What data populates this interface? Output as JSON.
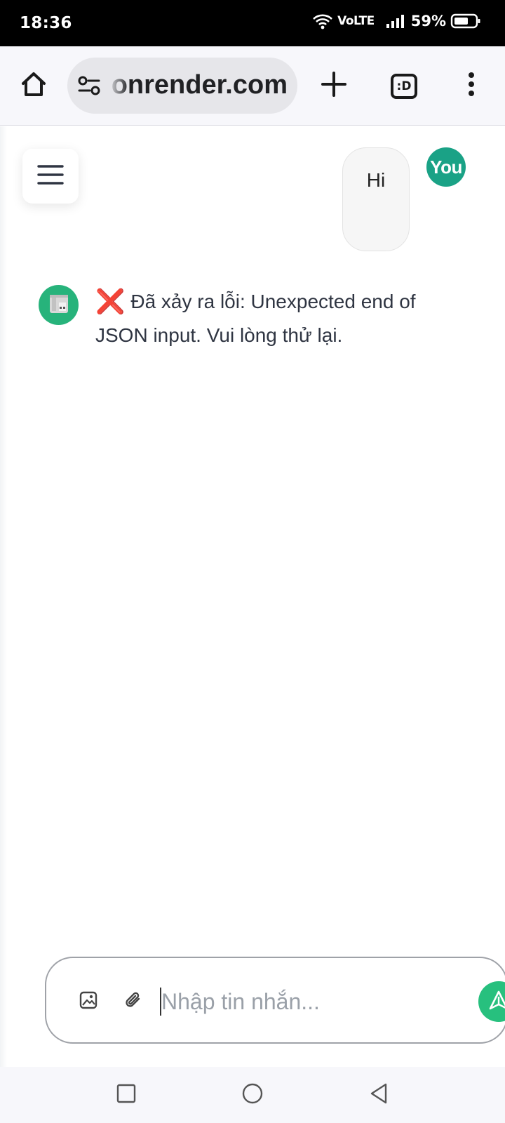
{
  "status_bar": {
    "time": "18:36",
    "network": "VoLTE",
    "battery": "59%",
    "icons": [
      "wifi-icon",
      "signal-icon",
      "battery-icon"
    ]
  },
  "browser": {
    "url": "onrender.com",
    "tabs_label": ":D",
    "icons": [
      "home-icon",
      "site-settings-icon",
      "new-tab-icon",
      "tab-switcher-icon",
      "more-icon"
    ]
  },
  "chat": {
    "menu_icon": "hamburger-menu-icon",
    "user": {
      "avatar_label": "You",
      "message": "Hi"
    },
    "bot": {
      "avatar_icon": "bot-avatar-icon",
      "error_icon": "❌",
      "message": "Đã xảy ra lỗi: Unexpected end of JSON input. Vui lòng thử lại."
    }
  },
  "composer": {
    "placeholder": "Nhập tin nhắn...",
    "value": "",
    "icons": [
      "image-icon",
      "attachment-icon",
      "send-icon"
    ]
  },
  "nav_bar": {
    "icons": [
      "recents-icon",
      "home-circle-icon",
      "back-icon"
    ]
  },
  "colors": {
    "accent": "#1aa286",
    "send": "#27c07e",
    "error": "#e0201b"
  }
}
